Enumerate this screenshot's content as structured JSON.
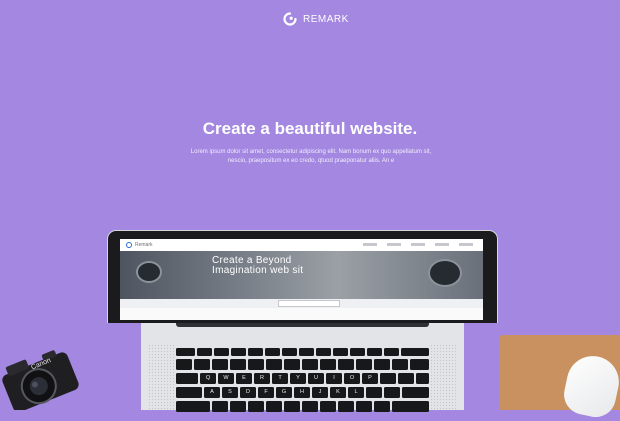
{
  "brand": {
    "name": "REMARK",
    "icon": "remark-logo-icon"
  },
  "hero": {
    "title": "Create a beautiful website.",
    "body": "Lorem ipsum dolor sit amet, consectetur adipiscing elit. Nam bonum ex quo appellatum sit, nescio, praepositum ex eo credo, qtuod praeponatur aliis. An e"
  },
  "laptop_screen": {
    "brand": "Remark",
    "title_line1": "Create a Beyond",
    "title_line2": "Imagination web sit"
  },
  "keyboard": {
    "row_qwerty": [
      "Q",
      "W",
      "E",
      "R",
      "T",
      "Y",
      "U",
      "I",
      "O",
      "P"
    ],
    "row_asdf": [
      "A",
      "S",
      "D",
      "F",
      "G",
      "H",
      "J",
      "K",
      "L"
    ]
  },
  "camera": {
    "brand": "Canon"
  },
  "colors": {
    "background": "#a387e0",
    "mousepad": "#c8915f",
    "laptop_frame": "#1b1b1e"
  }
}
